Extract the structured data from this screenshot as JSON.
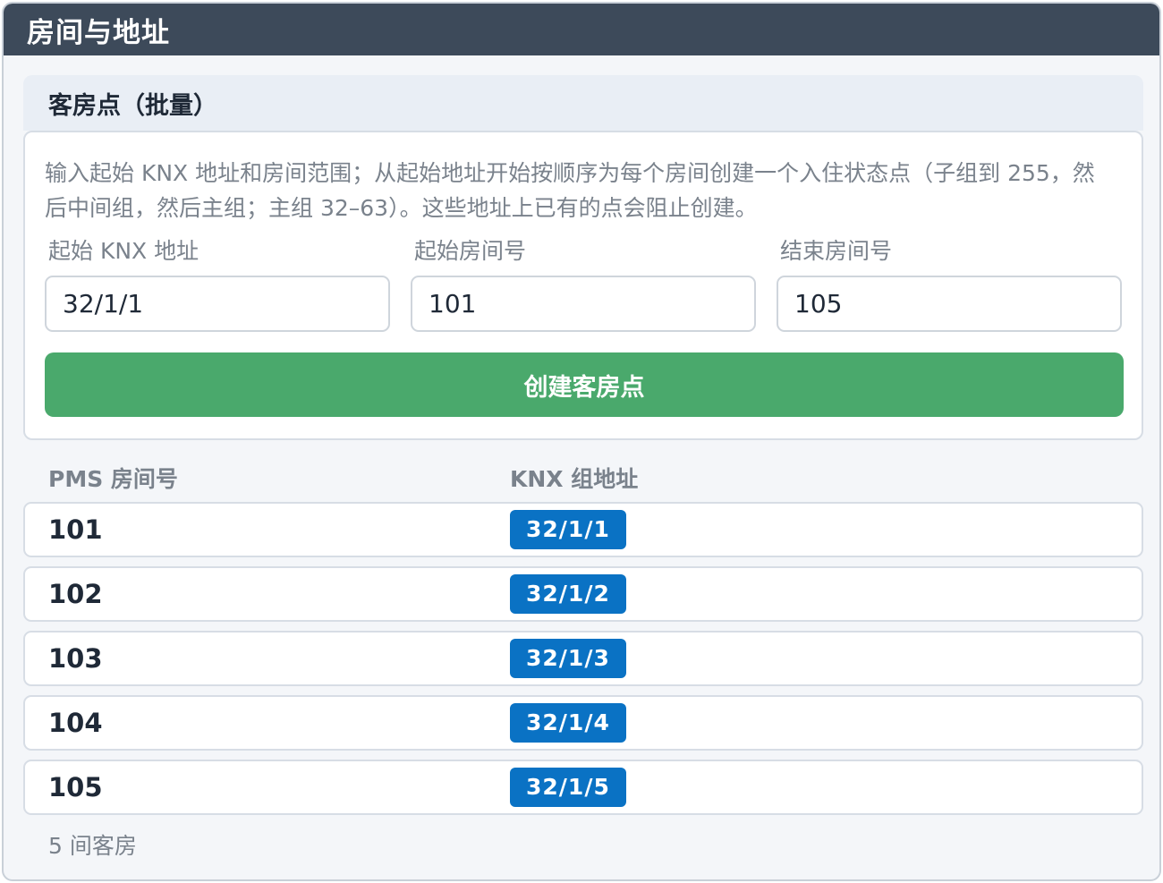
{
  "panel": {
    "title": "房间与地址"
  },
  "section": {
    "title": "客房点（批量）"
  },
  "form": {
    "help": "输入起始 KNX 地址和房间范围；从起始地址开始按顺序为每个房间创建一个入住状态点（子组到 255，然后中间组，然后主组；主组 32–63）。这些地址上已有的点会阻止创建。",
    "start_addr_label": "起始 KNX 地址",
    "start_addr_value": "32/1/1",
    "start_room_label": "起始房间号",
    "start_room_value": "101",
    "end_room_label": "结束房间号",
    "end_room_value": "105",
    "create_label": "创建客房点"
  },
  "table": {
    "headers": [
      "PMS 房间号",
      "KNX 组地址"
    ],
    "rows": [
      {
        "room": "101",
        "addr": "32/1/1"
      },
      {
        "room": "102",
        "addr": "32/1/2"
      },
      {
        "room": "103",
        "addr": "32/1/3"
      },
      {
        "room": "104",
        "addr": "32/1/4"
      },
      {
        "room": "105",
        "addr": "32/1/5"
      }
    ]
  },
  "footer": {
    "count": "5 间客房"
  },
  "colors": {
    "header_bg": "#3d4a5a",
    "button": "#4aa96c",
    "badge": "#0a72c4"
  }
}
